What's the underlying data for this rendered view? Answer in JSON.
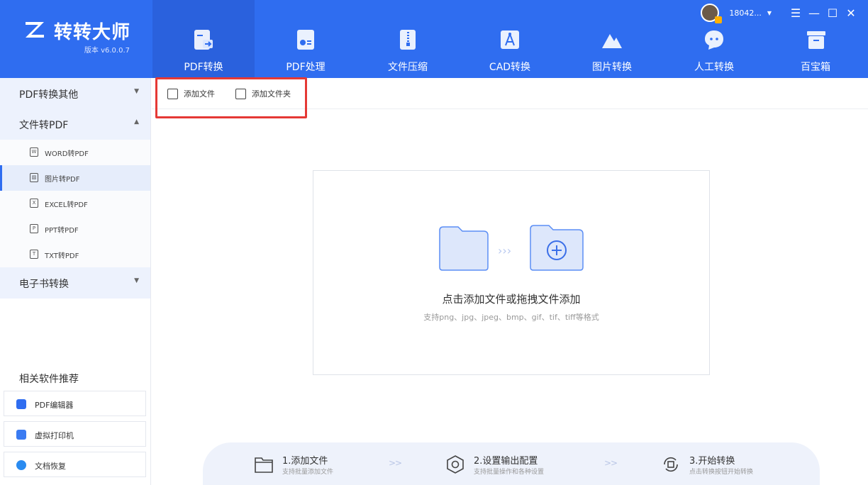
{
  "app": {
    "title": "转转大师",
    "version": "版本 v6.0.0.7"
  },
  "user": {
    "name": "18042...",
    "caret": "▼"
  },
  "window_controls": {
    "menu": "☰",
    "minimize": "—",
    "maximize": "☐",
    "close": "✕"
  },
  "nav": [
    {
      "label": "PDF转换",
      "icon": "pdf-convert-icon"
    },
    {
      "label": "PDF处理",
      "icon": "pdf-process-icon"
    },
    {
      "label": "文件压缩",
      "icon": "zip-icon"
    },
    {
      "label": "CAD转换",
      "icon": "cad-icon"
    },
    {
      "label": "图片转换",
      "icon": "image-mountain-icon"
    },
    {
      "label": "人工转换",
      "icon": "chat-bubble-icon"
    },
    {
      "label": "百宝箱",
      "icon": "toolbox-icon"
    }
  ],
  "sidebar": {
    "categories": [
      {
        "label": "PDF转换其他",
        "arrow": "▼"
      },
      {
        "label": "文件转PDF",
        "arrow": "▲"
      },
      {
        "label": "电子书转换",
        "arrow": "▼"
      }
    ],
    "sub_items": [
      {
        "label": "WORD转PDF",
        "icon_glyph": "W"
      },
      {
        "label": "图片转PDF",
        "icon_glyph": "▨"
      },
      {
        "label": "EXCEL转PDF",
        "icon_glyph": "X"
      },
      {
        "label": "PPT转PDF",
        "icon_glyph": "P"
      },
      {
        "label": "TXT转PDF",
        "icon_glyph": "T"
      }
    ],
    "recommend_title": "相关软件推荐",
    "recommend": [
      {
        "label": "PDF编辑器",
        "color": "#2f6df0"
      },
      {
        "label": "虚拟打印机",
        "color": "#3a7bf2"
      },
      {
        "label": "文档恢复",
        "color": "#2a8bf0"
      }
    ]
  },
  "toolbar": {
    "add_file": "添加文件",
    "add_folder": "添加文件夹"
  },
  "dropzone": {
    "title": "点击添加文件或拖拽文件添加",
    "subtitle": "支持png、jpg、jpeg、bmp、gif、tif、tiff等格式",
    "arrows": "›››"
  },
  "steps": [
    {
      "title": "1.添加文件",
      "desc": "支持批量添加文件"
    },
    {
      "title": "2.设置输出配置",
      "desc": "支持批量操作和各种设置"
    },
    {
      "title": "3.开始转换",
      "desc": "点击转换按钮开始转换"
    }
  ],
  "step_separator": ">>",
  "colors": {
    "brand": "#2f6df0",
    "highlight": "#e53935",
    "folder_fill": "#dde7fb",
    "folder_stroke": "#5b8ef5"
  }
}
